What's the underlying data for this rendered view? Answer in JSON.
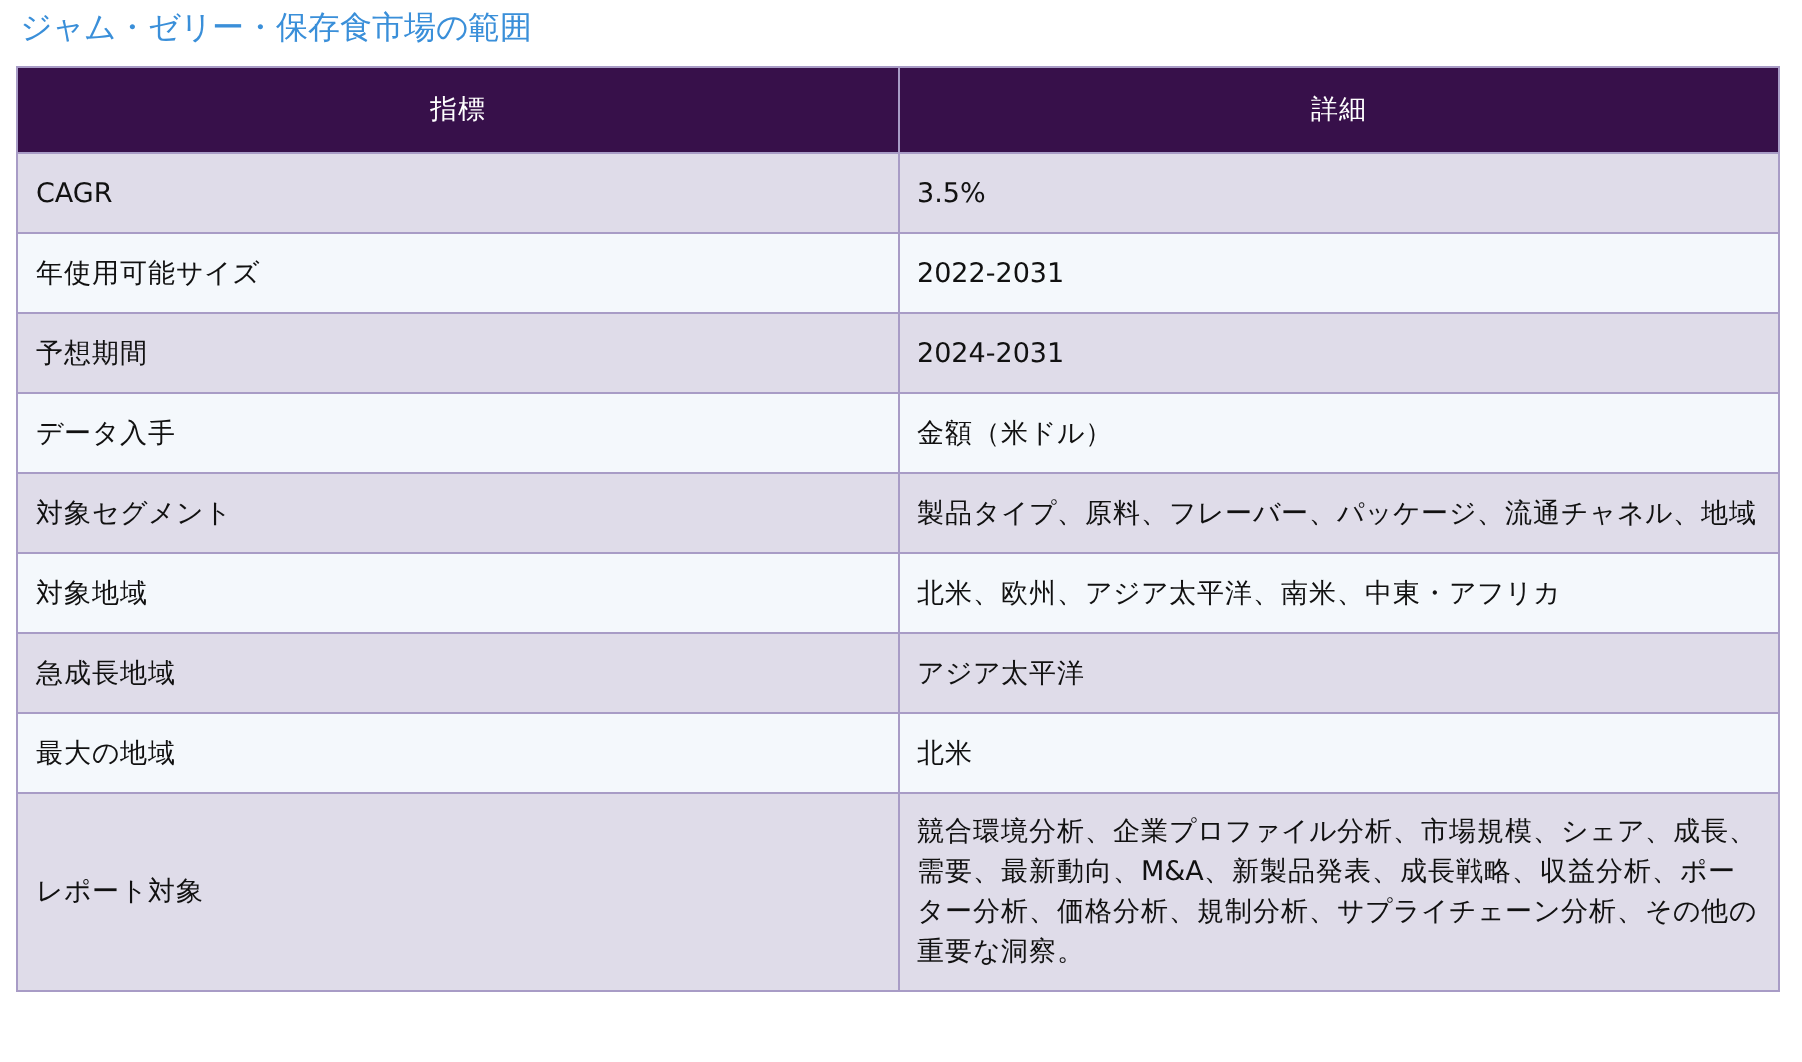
{
  "title": "ジャム・ゼリー・保存食市場の範囲",
  "table": {
    "columns": [
      "指標",
      "詳細"
    ],
    "rows": [
      [
        "CAGR",
        "3.5%"
      ],
      [
        "年使用可能サイズ",
        "2022-2031"
      ],
      [
        "予想期間",
        "2024-2031"
      ],
      [
        "データ入手",
        "金額（米ドル）"
      ],
      [
        "対象セグメント",
        "製品タイプ、原料、フレーバー、パッケージ、流通チャネル、地域"
      ],
      [
        "対象地域",
        "北米、欧州、アジア太平洋、南米、中東・アフリカ"
      ],
      [
        "急成長地域",
        "アジア太平洋"
      ],
      [
        "最大の地域",
        "北米"
      ],
      [
        "レポート対象",
        "競合環境分析、企業プロファイル分析、市場規模、シェア、成長、需要、最新動向、M&A、新製品発表、成長戦略、収益分析、ポーター分析、価格分析、規制分析、サプライチェーン分析、その他の重要な洞察。"
      ]
    ]
  }
}
